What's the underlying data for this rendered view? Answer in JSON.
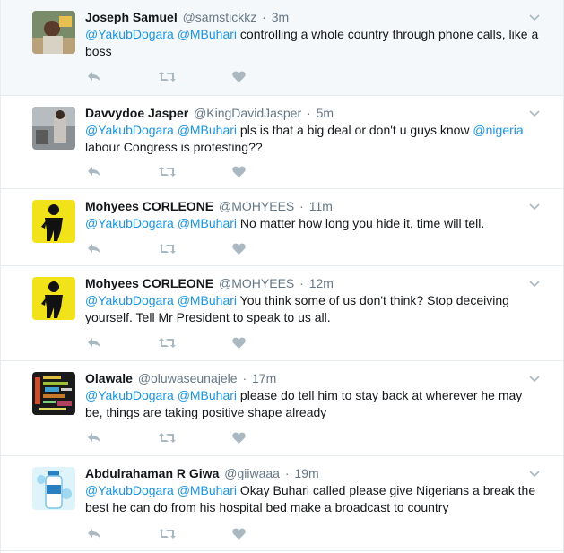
{
  "tweets": [
    {
      "fullname": "Joseph Samuel",
      "handle": "@samstickkz",
      "time": "3m",
      "mentions": [
        "@YakubDogara",
        "@MBuhari"
      ],
      "text": "controlling a whole country through phone calls, like a boss",
      "avatar_icon": "user-photo-avatar"
    },
    {
      "fullname": "Davvydoe Jasper",
      "handle": "@KingDavidJasper",
      "time": "5m",
      "mentions": [
        "@YakubDogara",
        "@MBuhari"
      ],
      "text_before": "pls is that a big deal or don't u guys know",
      "inline_mention": "@nigeria",
      "text_after": "labour Congress is protesting??",
      "avatar_icon": "user-photo-avatar"
    },
    {
      "fullname": "Mohyees CORLEONE",
      "handle": "@MOHYEES",
      "time": "11m",
      "mentions": [
        "@YakubDogara",
        "@MBuhari"
      ],
      "text": "No matter how long you hide it, time will tell.",
      "avatar_icon": "silhouette-yellow-avatar"
    },
    {
      "fullname": "Mohyees CORLEONE",
      "handle": "@MOHYEES",
      "time": "12m",
      "mentions": [
        "@YakubDogara",
        "@MBuhari"
      ],
      "text": "You think some of us don't think? Stop deceiving yourself. Tell Mr President to speak to us all.",
      "avatar_icon": "silhouette-yellow-avatar"
    },
    {
      "fullname": "Olawale",
      "handle": "@oluwaseunajele",
      "time": "17m",
      "mentions": [
        "@YakubDogara",
        "@MBuhari"
      ],
      "text": "please do tell him to stay back at wherever he may be, things are  taking positive shape  already",
      "avatar_icon": "word-cloud-avatar"
    },
    {
      "fullname": "Abdulrahaman R Giwa",
      "handle": "@giiwaaa",
      "time": "19m",
      "mentions": [
        "@YakubDogara",
        "@MBuhari"
      ],
      "text": "Okay Buhari called please give Nigerians a break the best he can do from his hospital bed make a broadcast to country",
      "avatar_icon": "water-bottle-avatar"
    }
  ],
  "separator": "·",
  "colors": {
    "link": "#1b95e0",
    "muted": "#657786",
    "action_icon": "#aab8c2",
    "border": "#e6ecf0",
    "highlight_bg": "#f5f8fa"
  }
}
